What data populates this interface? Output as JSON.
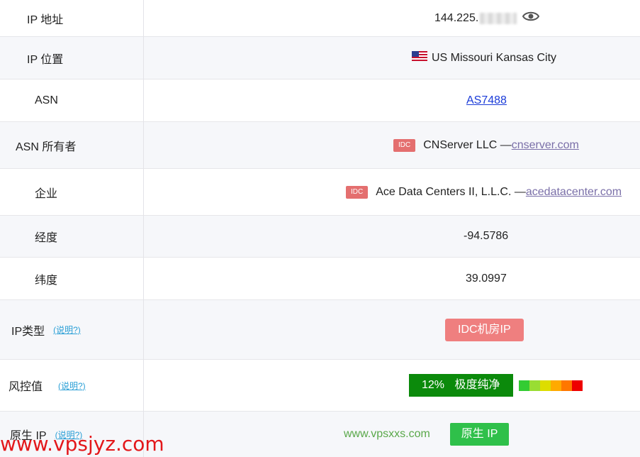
{
  "rows": [
    {
      "label": "IP 地址",
      "value_prefix": "144.225."
    },
    {
      "label": "IP 位置",
      "flag": "🇺🇸",
      "value": "US Missouri Kansas City"
    },
    {
      "label": "ASN",
      "value": "AS7488"
    },
    {
      "label": "ASN 所有者",
      "tag": "IDC",
      "value": "CNServer LLC —",
      "link": "cnserver.com"
    },
    {
      "label": "企业",
      "tag": "IDC",
      "value": "Ace Data Centers II, L.L.C. —",
      "link": "acedatacenter.com"
    },
    {
      "label": "经度",
      "value": "-94.5786"
    },
    {
      "label": "纬度",
      "value": "39.0997"
    },
    {
      "label": "IP类型",
      "help": "(说明?)",
      "badge": "IDC机房IP"
    },
    {
      "label": "风控值",
      "help": "(说明?)",
      "score": "12%",
      "score_text": "极度纯净"
    },
    {
      "label": "原生 IP",
      "help": "(说明?)",
      "badge": "原生 IP"
    }
  ],
  "risk_colors": [
    "#33cc33",
    "#99dd33",
    "#dddd00",
    "#ffaa00",
    "#ff7700",
    "#ee0000"
  ],
  "watermarks": {
    "green": "www.vpsxxs.com",
    "red": "www.vpsjyz.com"
  },
  "icons": {
    "visibility": "eye-icon",
    "flag": "us-flag-icon"
  }
}
